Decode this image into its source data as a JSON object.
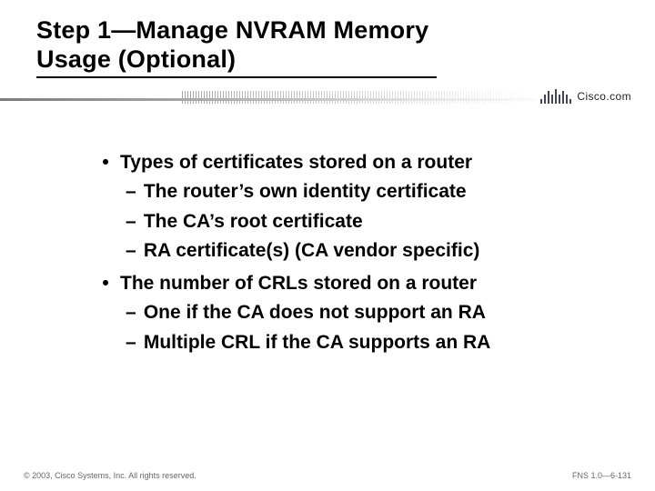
{
  "title": {
    "line1": "Step 1—Manage NVRAM Memory",
    "line2": "Usage (Optional)"
  },
  "brand": {
    "name": "Cisco.com"
  },
  "bullets": [
    {
      "text": "Types of certificates stored on a router",
      "subs": [
        "The router’s own identity certificate",
        "The CA’s root certificate",
        "RA certificate(s) (CA vendor specific)"
      ]
    },
    {
      "text": "The number of CRLs stored on a router",
      "subs": [
        "One if the CA does not support an RA",
        "Multiple CRL if the CA supports an RA"
      ]
    }
  ],
  "footer": {
    "copyright": "© 2003, Cisco Systems, Inc. All rights reserved.",
    "pageref": "FNS 1.0—6-131"
  }
}
